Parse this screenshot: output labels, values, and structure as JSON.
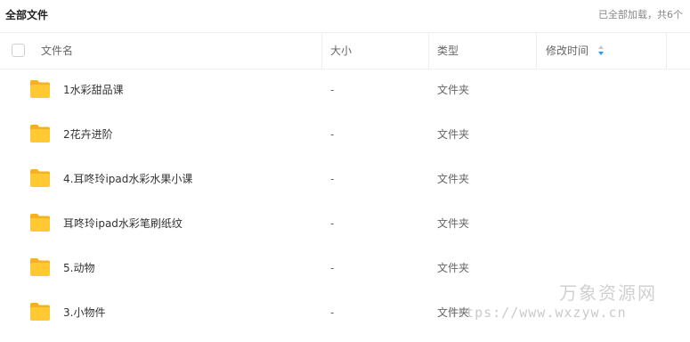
{
  "breadcrumb": "全部文件",
  "load_status": "已全部加载，共6个",
  "columns": {
    "name": "文件名",
    "size": "大小",
    "type": "类型",
    "modified": "修改时间"
  },
  "files": [
    {
      "name": "1水彩甜品课",
      "size": "-",
      "type": "文件夹"
    },
    {
      "name": "2花卉进阶",
      "size": "-",
      "type": "文件夹"
    },
    {
      "name": "4.耳咚玲ipad水彩水果小课",
      "size": "-",
      "type": "文件夹"
    },
    {
      "name": "耳咚玲ipad水彩笔刷纸纹",
      "size": "-",
      "type": "文件夹"
    },
    {
      "name": "5.动物",
      "size": "-",
      "type": "文件夹"
    },
    {
      "name": "3.小物件",
      "size": "-",
      "type": "文件夹"
    }
  ],
  "watermark": {
    "title": "万象资源网",
    "url": "https://www.wxzyw.cn"
  },
  "colors": {
    "folder": "#FFC933",
    "sort_arrow_active": "#2A9BF4"
  },
  "icons": {
    "folder": "folder-icon",
    "sort": "sort-icon",
    "checkbox": "select-all-checkbox"
  }
}
